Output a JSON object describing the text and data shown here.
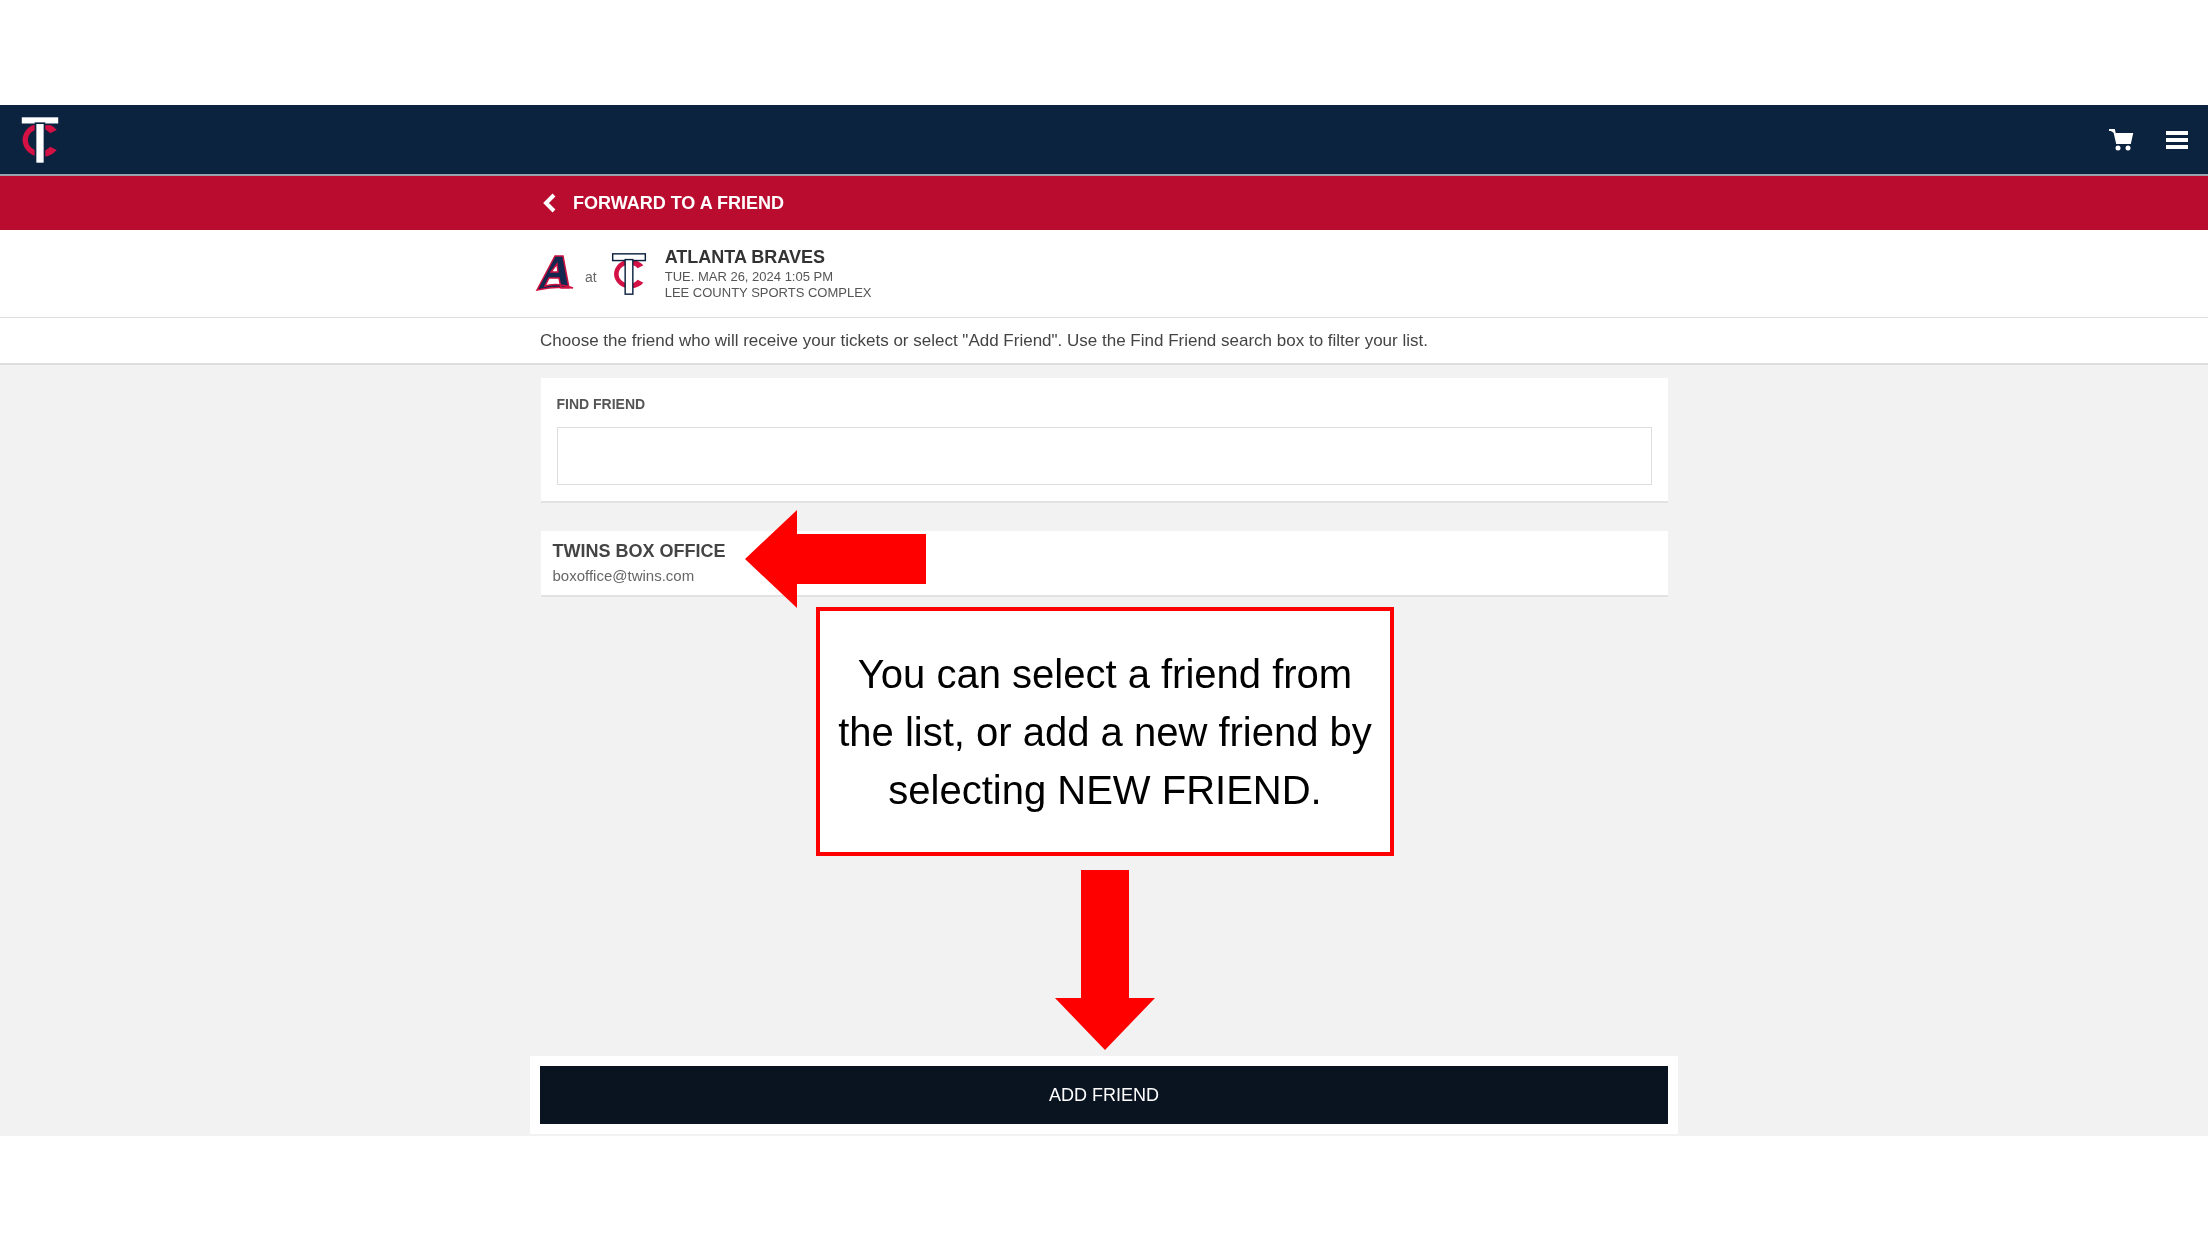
{
  "header": {
    "back_label": "FORWARD TO A FRIEND"
  },
  "event": {
    "connector": "at",
    "title": "ATLANTA BRAVES",
    "datetime": "TUE. MAR 26, 2024 1:05 PM",
    "venue": "LEE COUNTY SPORTS COMPLEX"
  },
  "instructions": "Choose the friend who will receive your tickets or select \"Add Friend\". Use the Find Friend search box to filter your list.",
  "find_friend": {
    "label": "FIND FRIEND"
  },
  "friends": [
    {
      "name": "TWINS BOX OFFICE",
      "email": "boxoffice@twins.com"
    }
  ],
  "callout": {
    "text": "You can select a friend from the list, or add a new friend by selecting NEW FRIEND."
  },
  "add_button": {
    "label": "ADD FRIEND"
  }
}
